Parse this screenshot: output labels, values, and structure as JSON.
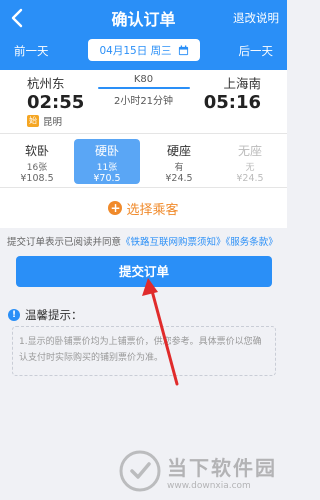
{
  "header": {
    "title": "确认订单",
    "refund_link": "退改说明",
    "prev_day": "前一天",
    "next_day": "后一天",
    "date": "04月15日 周三"
  },
  "train": {
    "from_station": "杭州东",
    "to_station": "上海南",
    "train_no": "K80",
    "dep_time": "02:55",
    "arr_time": "05:16",
    "duration": "2小时21分钟",
    "stop_badge": "始",
    "stop_name": "昆明"
  },
  "seats": [
    {
      "type": "软卧",
      "count": "16张",
      "price": "¥108.5",
      "state": "normal"
    },
    {
      "type": "硬卧",
      "count": "11张",
      "price": "¥70.5",
      "state": "selected"
    },
    {
      "type": "硬座",
      "count": "有",
      "price": "¥24.5",
      "state": "normal"
    },
    {
      "type": "无座",
      "count": "无",
      "price": "¥24.5",
      "state": "disabled"
    }
  ],
  "select_passenger": "选择乘客",
  "agreement": {
    "prefix": "提交订单表示已阅读并同意",
    "link1": "《铁路互联网购票须知》",
    "link2": "《服务条款》"
  },
  "submit_label": "提交订单",
  "tips": {
    "title": "温馨提示：",
    "body": "1.显示的卧铺票价均为上铺票价，供您参考。具体票价以您确认支付时实际购买的铺别票价为准。"
  },
  "watermark": {
    "name": "当下软件园",
    "url": "www.downxia.com"
  },
  "colors": {
    "primary": "#2a8ff7",
    "accent": "#f08a2b"
  }
}
